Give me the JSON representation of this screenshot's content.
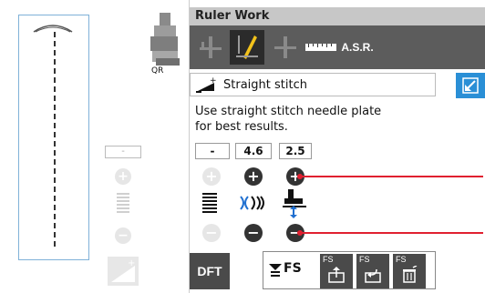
{
  "left_panel": {
    "foot_label": "QR",
    "ghost_value": "-"
  },
  "right_panel": {
    "title": "Ruler Work",
    "toolbar": {
      "asr_label": "A.S.R."
    },
    "stitch_name": "Straight stitch",
    "message_line1": "Use straight stitch needle plate",
    "message_line2": "for best results.",
    "values": [
      "-",
      "4.6",
      "2.5"
    ],
    "dft_label": "DFT",
    "fs_label": "FS",
    "fs_main": "FS"
  },
  "colors": {
    "accent_blue": "#2a8fd6",
    "red_line": "#e02030",
    "toolbar_gray": "#5c5c5c"
  }
}
